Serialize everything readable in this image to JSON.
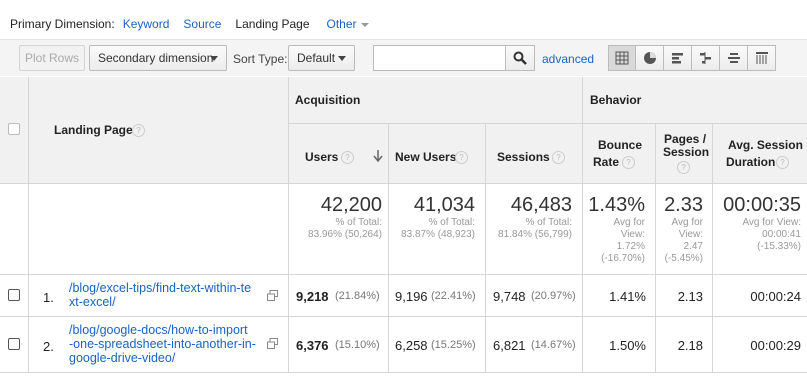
{
  "dimension_bar": {
    "label": "Primary Dimension:",
    "options": [
      "Keyword",
      "Source"
    ],
    "active": "Landing Page",
    "other": "Other"
  },
  "toolbar": {
    "plot_rows": "Plot Rows",
    "secondary_dimension": "Secondary dimension",
    "sort_type_label": "Sort Type:",
    "sort_type_value": "Default",
    "search_value": "",
    "advanced": "advanced",
    "view_icons": [
      "table-view-icon",
      "pie-view-icon",
      "performance-view-icon",
      "comparison-view-icon",
      "term-cloud-view-icon",
      "pivot-view-icon"
    ]
  },
  "table": {
    "landing_page_header": "Landing Page",
    "groups": {
      "acquisition": "Acquisition",
      "behavior": "Behavior"
    },
    "columns": {
      "users": "Users",
      "new_users": "New Users",
      "sessions": "Sessions",
      "bounce_line1": "Bounce",
      "bounce_line2": "Rate",
      "pages_line1": "Pages /",
      "pages_line2": "Session",
      "duration_line1": "Avg. Session",
      "duration_line2": "Duration"
    },
    "totals": {
      "users": {
        "value": "42,200",
        "l1": "% of Total:",
        "l2": "83.96% (50,264)"
      },
      "new_users": {
        "value": "41,034",
        "l1": "% of Total:",
        "l2": "83.87% (48,923)"
      },
      "sessions": {
        "value": "46,483",
        "l1": "% of Total:",
        "l2": "81.84% (56,799)"
      },
      "bounce": {
        "value": "1.43%",
        "l1": "Avg for",
        "l2": "View:",
        "l3": "1.72%",
        "l4": "(-16.70%)"
      },
      "pages": {
        "value": "2.33",
        "l1": "Avg for",
        "l2": "View:",
        "l3": "2.47",
        "l4": "(-5.45%)"
      },
      "duration": {
        "value": "00:00:35",
        "l1": "Avg for View:",
        "l2": "00:00:41",
        "l3": "(-15.33%)"
      }
    },
    "rows": [
      {
        "index": "1.",
        "page_lines": [
          "/blog/excel-tips/find-text-within-te",
          "xt-excel/"
        ],
        "users": "9,218",
        "users_pct": "(21.84%)",
        "new_users": "9,196",
        "new_users_pct": "(22.41%)",
        "sessions": "9,748",
        "sessions_pct": "(20.97%)",
        "bounce": "1.41%",
        "pages": "2.13",
        "duration": "00:00:24"
      },
      {
        "index": "2.",
        "page_lines": [
          "/blog/google-docs/how-to-import",
          "-one-spreadsheet-into-another-in-",
          "google-drive-video/"
        ],
        "users": "6,376",
        "users_pct": "(15.10%)",
        "new_users": "6,258",
        "new_users_pct": "(15.25%)",
        "sessions": "6,821",
        "sessions_pct": "(14.67%)",
        "bounce": "1.50%",
        "pages": "2.18",
        "duration": "00:00:29"
      }
    ]
  },
  "colors": {
    "link": "#1a62c7",
    "header_bg": "#f1f1f1",
    "toolbar_bg": "#f4f4f4"
  }
}
